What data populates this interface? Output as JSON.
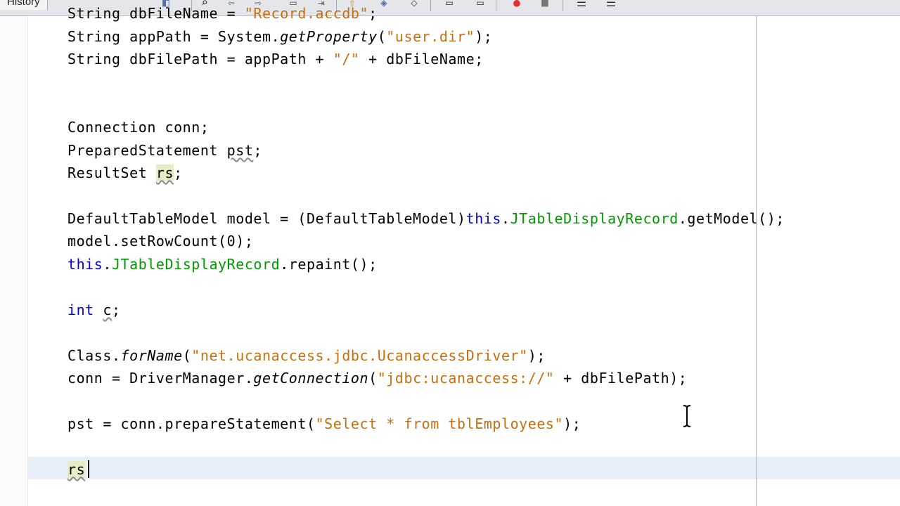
{
  "toolbar": {
    "history_tab": "History",
    "buttons": [
      "toggle-icon",
      "search-icon",
      "back-icon",
      "forward-icon",
      "toggle-bookmark-icon",
      "next-bookmark-icon",
      "shift-left-icon",
      "shift-right-icon",
      "record-macro-icon",
      "stop-macro-icon",
      "comment-icon",
      "uncomment-icon"
    ]
  },
  "editor": {
    "lines": {
      "l1": {
        "t1": "String dbFileName = ",
        "s1": "\"Record.accdb\"",
        "t2": ";"
      },
      "l2": {
        "t1": "String appPath = System.",
        "m1": "getProperty",
        "t2": "(",
        "s1": "\"user.dir\"",
        "t3": ");"
      },
      "l3": {
        "t1": "String dbFilePath = appPath + ",
        "s1": "\"/\"",
        "t2": " + dbFileName;"
      },
      "l4": {
        "t1": "Connection conn;"
      },
      "l5": {
        "t1": "PreparedStatement ",
        "v1": "pst",
        "t2": ";"
      },
      "l6": {
        "t1": "ResultSet ",
        "v1": "rs",
        "t2": ";"
      },
      "l7": {
        "t1": "DefaultTableModel model = (DefaultTableModel)",
        "k1": "this",
        "t2": ".",
        "f1": "JTableDisplayRecord",
        "t3": ".getModel();"
      },
      "l8": {
        "t1": "model.setRowCount(0);"
      },
      "l9": {
        "k1": "this",
        "t1": ".",
        "f1": "JTableDisplayRecord",
        "t2": ".repaint();"
      },
      "l10": {
        "k1": "int",
        "t1": " ",
        "v1": "c",
        "t2": ";"
      },
      "l11": {
        "t1": "Class.",
        "m1": "forName",
        "t2": "(",
        "s1": "\"net.ucanaccess.jdbc.UcanaccessDriver\"",
        "t3": ");"
      },
      "l12": {
        "t1": "conn = DriverManager.",
        "m1": "getConnection",
        "t2": "(",
        "s1": "\"jdbc:ucanaccess://\"",
        "t3": " + dbFilePath);"
      },
      "l13": {
        "t1": "pst = conn.prepareStatement(",
        "s1": "\"Select * from tblEmployees\"",
        "t2": ");"
      },
      "l14": {
        "v1": "rs"
      }
    }
  },
  "colors": {
    "string": "#c66f0e",
    "field": "#009900",
    "keyword": "#0000e6",
    "margin_line": "#f19a9a",
    "current_line": "#e9eff8"
  }
}
